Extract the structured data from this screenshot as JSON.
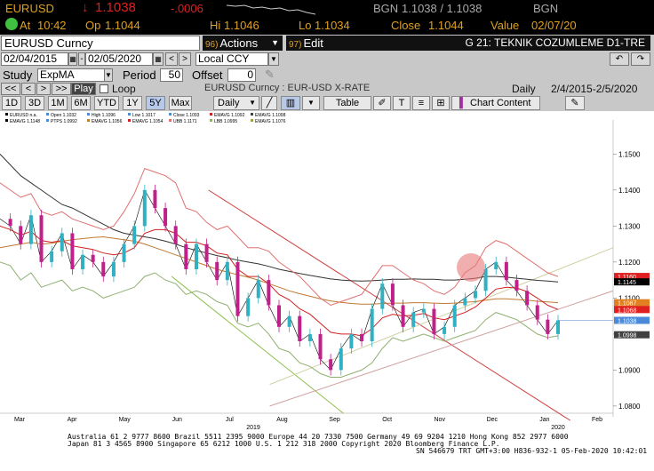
{
  "quote": {
    "ticker": "EURUSD",
    "last_arrow": "↓",
    "last": "1.1038",
    "change": "-.0006",
    "bgn_label": "BGN",
    "bgn_value": "1.1038 / 1.1038",
    "bgn_short": "BGN",
    "at_label": "At",
    "at_value": "10:42",
    "op_label": "Op",
    "op_value": "1.1044",
    "hi_label": "Hi",
    "hi_value": "1.1046",
    "lo_label": "Lo",
    "lo_value": "1.1034",
    "close_label": "Close",
    "close_value": "1.1044",
    "value_label": "Value",
    "value_date": "02/07/20"
  },
  "toolbar": {
    "security": "EURUSD  Curncy",
    "actions_num": "96)",
    "actions_label": "Actions",
    "edit_num": "97)",
    "edit_label": "Edit",
    "title": "G 21: TEKNIK COZUMLEME D1-TRE"
  },
  "range": {
    "start_date": "02/04/2015",
    "end_date": "02/05/2020",
    "currency": "Local CCY"
  },
  "study": {
    "label": "Study",
    "value": "ExpMA",
    "period_label": "Period",
    "period_value": "50",
    "offset_label": "Offset",
    "offset_value": "0"
  },
  "playback": {
    "first": "<<",
    "prev": "<",
    "next": ">",
    "last": ">>",
    "play": "Play",
    "loop": "Loop",
    "security_desc": "EURUSD  Curncy : EUR-USD X-RATE",
    "frequency": "Daily",
    "date_range": "2/4/2015-2/5/2020"
  },
  "periods": [
    "1D",
    "3D",
    "1M",
    "6M",
    "YTD",
    "1Y",
    "5Y",
    "Max"
  ],
  "selected_period": "5Y",
  "chart_controls": {
    "freq": "Daily",
    "table": "Table",
    "chart_content": "Chart Content"
  },
  "legend": [
    {
      "name": "EURUSD",
      "value": "n.a.",
      "color": "#000000"
    },
    {
      "name": "Open",
      "value": "1.1032",
      "color": "#4a8ad8"
    },
    {
      "name": "High",
      "value": "1.1096",
      "color": "#4a8ad8"
    },
    {
      "name": "Low",
      "value": "1.1017",
      "color": "#4a8ad8"
    },
    {
      "name": "Close",
      "value": "1.1093",
      "color": "#4a8ad8"
    },
    {
      "name": "EMAVG",
      "value": "1.1092",
      "color": "#d02020"
    },
    {
      "name": "EMAVG",
      "value": "1.1098",
      "color": "#404040"
    },
    {
      "name": "EMAVG",
      "value": "1.1148",
      "color": "#000000"
    },
    {
      "name": "PTPS",
      "value": "1.0992",
      "color": "#4a8ad8"
    },
    {
      "name": "EMAVG",
      "value": "1.1056",
      "color": "#c08030"
    },
    {
      "name": "EMAVG",
      "value": "1.1054",
      "color": "#d02020"
    },
    {
      "name": "UBB",
      "value": "1.1171",
      "color": "#e07070"
    },
    {
      "name": "LBB",
      "value": "1.0995",
      "color": "#90b070"
    },
    {
      "name": "EMAVG",
      "value": "1.1076",
      "color": "#a0a040"
    }
  ],
  "chart_data": {
    "type": "line",
    "y_ticks": [
      "1.1500",
      "1.1400",
      "1.1300",
      "1.1200",
      "1.1100",
      "1.1000",
      "1.0900",
      "1.0800"
    ],
    "ylim": [
      1.078,
      1.157
    ],
    "x_ticks": [
      "Mar",
      "Apr",
      "May",
      "Jun",
      "Jul",
      "Aug",
      "Sep",
      "Oct",
      "Nov",
      "Dec",
      "Jan",
      "Feb"
    ],
    "year_labels": [
      "2019",
      "2020"
    ],
    "price_tags": [
      {
        "value": "1.1160",
        "color": "#e02020"
      },
      {
        "value": "1.1145",
        "color": "#000000"
      },
      {
        "value": "1.1087",
        "color": "#e08020"
      },
      {
        "value": "1.1068",
        "color": "#e02020"
      },
      {
        "value": "1.1038",
        "color": "#4a8ad8"
      },
      {
        "value": "1.0998",
        "color": "#404040"
      }
    ],
    "series": [
      {
        "name": "EURUSD",
        "color": "#000000",
        "values": [
          1.132,
          1.13,
          1.125,
          1.133,
          1.12,
          1.123,
          1.128,
          1.118,
          1.122,
          1.12,
          1.116,
          1.12,
          1.125,
          1.13,
          1.14,
          1.135,
          1.13,
          1.125,
          1.118,
          1.125,
          1.12,
          1.115,
          1.12,
          1.105,
          1.11,
          1.115,
          1.108,
          1.102,
          1.105,
          1.098,
          1.1,
          1.093,
          1.09,
          1.096,
          1.1,
          1.098,
          1.107,
          1.114,
          1.108,
          1.102,
          1.106,
          1.107,
          1.1,
          1.102,
          1.108,
          1.11,
          1.112,
          1.118,
          1.12,
          1.115,
          1.112,
          1.108,
          1.104,
          1.1,
          1.1038
        ]
      },
      {
        "name": "EMAVG",
        "color": "#333333",
        "values": [
          1.15,
          1.147,
          1.144,
          1.142,
          1.14,
          1.138,
          1.136,
          1.135,
          1.1335,
          1.132,
          1.1305,
          1.129,
          1.128,
          1.1275,
          1.127,
          1.1265,
          1.1258,
          1.125,
          1.124,
          1.1232,
          1.1225,
          1.1218,
          1.1212,
          1.1205,
          1.12,
          1.1195,
          1.1188,
          1.118,
          1.1174,
          1.1168,
          1.1163,
          1.1158,
          1.1153,
          1.115,
          1.1148,
          1.1147,
          1.1148,
          1.115,
          1.1152,
          1.1152,
          1.1153,
          1.1152,
          1.1152,
          1.115,
          1.115,
          1.1152,
          1.1155,
          1.116,
          1.116,
          1.1158,
          1.1155,
          1.1152,
          1.1149,
          1.1147,
          1.1145
        ]
      },
      {
        "name": "EMAVG",
        "color": "#c07830",
        "values": [
          1.124,
          1.1245,
          1.125,
          1.1255,
          1.125,
          1.1252,
          1.1258,
          1.1262,
          1.1265,
          1.1268,
          1.127,
          1.1266,
          1.1262,
          1.1258,
          1.125,
          1.124,
          1.123,
          1.122,
          1.121,
          1.12,
          1.119,
          1.118,
          1.1172,
          1.1165,
          1.1158,
          1.115,
          1.114,
          1.113,
          1.112,
          1.1112,
          1.1105,
          1.1098,
          1.1092,
          1.1088,
          1.1085,
          1.1083,
          1.1083,
          1.1085,
          1.1086,
          1.1086,
          1.1087,
          1.1087,
          1.1086,
          1.1085,
          1.1086,
          1.1088,
          1.109,
          1.1094,
          1.1098,
          1.1098,
          1.1096,
          1.1094,
          1.1091,
          1.1089,
          1.1087
        ]
      },
      {
        "name": "EMAVG",
        "color": "#d02020",
        "values": [
          1.13,
          1.129,
          1.1275,
          1.1285,
          1.126,
          1.1255,
          1.126,
          1.1245,
          1.124,
          1.1235,
          1.1225,
          1.122,
          1.1225,
          1.124,
          1.128,
          1.129,
          1.129,
          1.128,
          1.1255,
          1.1255,
          1.1245,
          1.1225,
          1.122,
          1.118,
          1.116,
          1.116,
          1.114,
          1.111,
          1.1095,
          1.107,
          1.1055,
          1.103,
          1.1005,
          1.1,
          1.1,
          1.0995,
          1.1015,
          1.1045,
          1.1055,
          1.105,
          1.1052,
          1.1057,
          1.1045,
          1.104,
          1.105,
          1.106,
          1.1075,
          1.11,
          1.1125,
          1.113,
          1.1128,
          1.1118,
          1.11,
          1.108,
          1.1068
        ]
      },
      {
        "name": "UBB",
        "color": "#e07070",
        "values": [
          1.142,
          1.14,
          1.138,
          1.139,
          1.134,
          1.133,
          1.134,
          1.132,
          1.131,
          1.13,
          1.129,
          1.13,
          1.134,
          1.139,
          1.146,
          1.145,
          1.144,
          1.142,
          1.135,
          1.134,
          1.131,
          1.129,
          1.13,
          1.127,
          1.124,
          1.124,
          1.123,
          1.12,
          1.118,
          1.116,
          1.113,
          1.11,
          1.108,
          1.109,
          1.11,
          1.111,
          1.115,
          1.119,
          1.119,
          1.117,
          1.115,
          1.114,
          1.112,
          1.111,
          1.113,
          1.117,
          1.119,
          1.124,
          1.126,
          1.125,
          1.123,
          1.121,
          1.119,
          1.117,
          1.116
        ]
      },
      {
        "name": "LBB",
        "color": "#90b070",
        "values": [
          1.12,
          1.119,
          1.115,
          1.117,
          1.113,
          1.114,
          1.115,
          1.112,
          1.113,
          1.112,
          1.11,
          1.111,
          1.112,
          1.113,
          1.116,
          1.117,
          1.115,
          1.114,
          1.111,
          1.112,
          1.111,
          1.109,
          1.108,
          1.103,
          1.102,
          1.103,
          1.1,
          1.096,
          1.095,
          1.092,
          1.091,
          1.089,
          1.088,
          1.088,
          1.089,
          1.09,
          1.092,
          1.096,
          1.099,
          1.098,
          1.099,
          1.1,
          1.099,
          1.098,
          1.099,
          1.1,
          1.101,
          1.104,
          1.106,
          1.105,
          1.104,
          1.102,
          1.1,
          1.099,
          1.0995
        ]
      }
    ],
    "trend_lines": [
      {
        "color": "#d04040",
        "x0": 0.34,
        "y0": 1.14,
        "x1": 0.93,
        "y1": 1.076
      },
      {
        "color": "#90c050",
        "x0": 0.28,
        "y0": 1.116,
        "x1": 0.56,
        "y1": 1.078
      },
      {
        "color": "#d0d0a0",
        "x0": 0.44,
        "y0": 1.086,
        "x1": 1.0,
        "y1": 1.124
      },
      {
        "color": "#d0a0a0",
        "x0": 0.44,
        "y0": 1.08,
        "x1": 1.0,
        "y1": 1.112
      }
    ]
  },
  "footer": {
    "line1": "Australia 61 2 9777 8600 Brazil 5511 2395 9000 Europe 44 20 7330 7500 Germany 49 69 9204 1210 Hong Kong 852 2977 6000",
    "line2": "Japan 81 3 4565 8900       Singapore 65 6212 1000        U.S. 1 212 318 2000             Copyright 2020 Bloomberg Finance L.P.",
    "line3": "SN 546679 TRT  GMT+3:00 H836-932-1 05-Feb-2020 10:42:01"
  }
}
